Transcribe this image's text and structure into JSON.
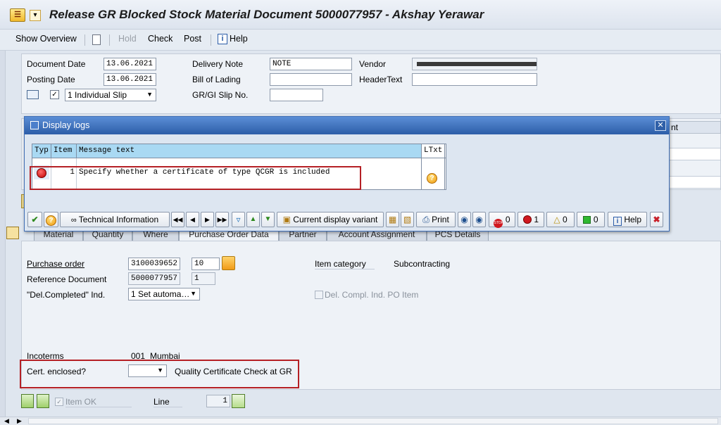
{
  "title": "Release GR Blocked Stock Material Document 5000077957 - Akshay Yerawar",
  "toolbar": {
    "show_overview": "Show Overview",
    "hold": "Hold",
    "check": "Check",
    "post": "Post",
    "help": "Help"
  },
  "header": {
    "document_date_label": "Document Date",
    "document_date": "13.06.2021",
    "posting_date_label": "Posting Date",
    "posting_date": "13.06.2021",
    "slip_option": "1 Individual Slip",
    "delivery_note_label": "Delivery Note",
    "delivery_note": "NOTE",
    "bill_of_lading_label": "Bill of Lading",
    "gr_gi_slip_label": "GR/GI Slip No.",
    "vendor_label": "Vendor",
    "header_text_label": "HeaderText"
  },
  "dialog": {
    "title": "Display logs",
    "columns": [
      "Typ",
      "Item",
      "Message text",
      "LTxt"
    ],
    "rows": [
      {
        "type": "error",
        "item": "1",
        "message": "Specify whether a certificate of type QCGR is included"
      }
    ],
    "buttons": {
      "technical_information": "Technical Information",
      "current_display_variant": "Current display variant",
      "print": "Print",
      "stop_count": "0",
      "error_count": "1",
      "warning_count": "0",
      "success_count": "0",
      "help": "Help"
    },
    "behind_fragment": "nt"
  },
  "tabs": [
    "Material",
    "Quantity",
    "Where",
    "Purchase Order Data",
    "Partner",
    "Account Assignment",
    "PCS Details"
  ],
  "po_data": {
    "purchase_order_label": "Purchase order",
    "purchase_order": "3100039652",
    "po_item": "10",
    "reference_document_label": "Reference Document",
    "reference_document": "5000077957",
    "reference_item": "1",
    "del_completed_label": "\"Del.Completed\" Ind.",
    "del_completed_value": "1 Set automa…",
    "item_category_label": "Item category",
    "item_category_value": "Subcontracting",
    "del_compl_po_label": "Del. Compl. Ind. PO Item",
    "incoterms_label": "Incoterms",
    "incoterms_code": "001",
    "incoterms_place": "Mumbai",
    "cert_enclosed_label": "Cert. enclosed?",
    "cert_enclosed_value": "",
    "cert_enclosed_desc": "Quality Certificate Check at GR"
  },
  "footer": {
    "item_ok": "Item OK",
    "line_label": "Line",
    "line_value": "1"
  },
  "colors": {
    "dialog_title": "#2c5da8",
    "grid_header": "#a9d9f3",
    "highlight_border": "#b52025"
  }
}
